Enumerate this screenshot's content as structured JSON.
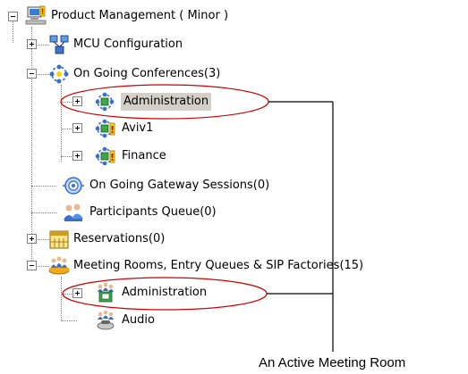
{
  "tree": {
    "root": {
      "label": "Product Management   ( Minor )"
    },
    "mcu_configuration": {
      "label": "MCU Configuration"
    },
    "on_going_conferences": {
      "label": "On Going Conferences(3)"
    },
    "conferences": [
      {
        "label": "Administration"
      },
      {
        "label": "Aviv1"
      },
      {
        "label": "Finance"
      }
    ],
    "gateway_sessions": {
      "label": "On Going Gateway Sessions(0)"
    },
    "participants_queue": {
      "label": "Participants Queue(0)"
    },
    "reservations": {
      "label": "Reservations(0)"
    },
    "meeting_rooms": {
      "label": "Meeting Rooms, Entry Queues & SIP Factories(15)"
    },
    "rooms": [
      {
        "label": "Administration"
      },
      {
        "label": "Audio"
      }
    ]
  },
  "annotation": {
    "text": "An Active Meeting Room",
    "color": "#cc0000"
  },
  "icons": {
    "root": "network-computer-warning-icon",
    "mcu": "mcu-network-icon",
    "conferences": "conferences-globe-icon",
    "conference": "conference-warning-icon",
    "gateway": "gateway-sessions-icon",
    "participants": "participants-queue-icon",
    "reservations": "reservations-calendar-icon",
    "meeting_rooms": "meeting-rooms-icon",
    "room_active": "active-meeting-room-icon",
    "room": "meeting-room-phone-icon"
  }
}
